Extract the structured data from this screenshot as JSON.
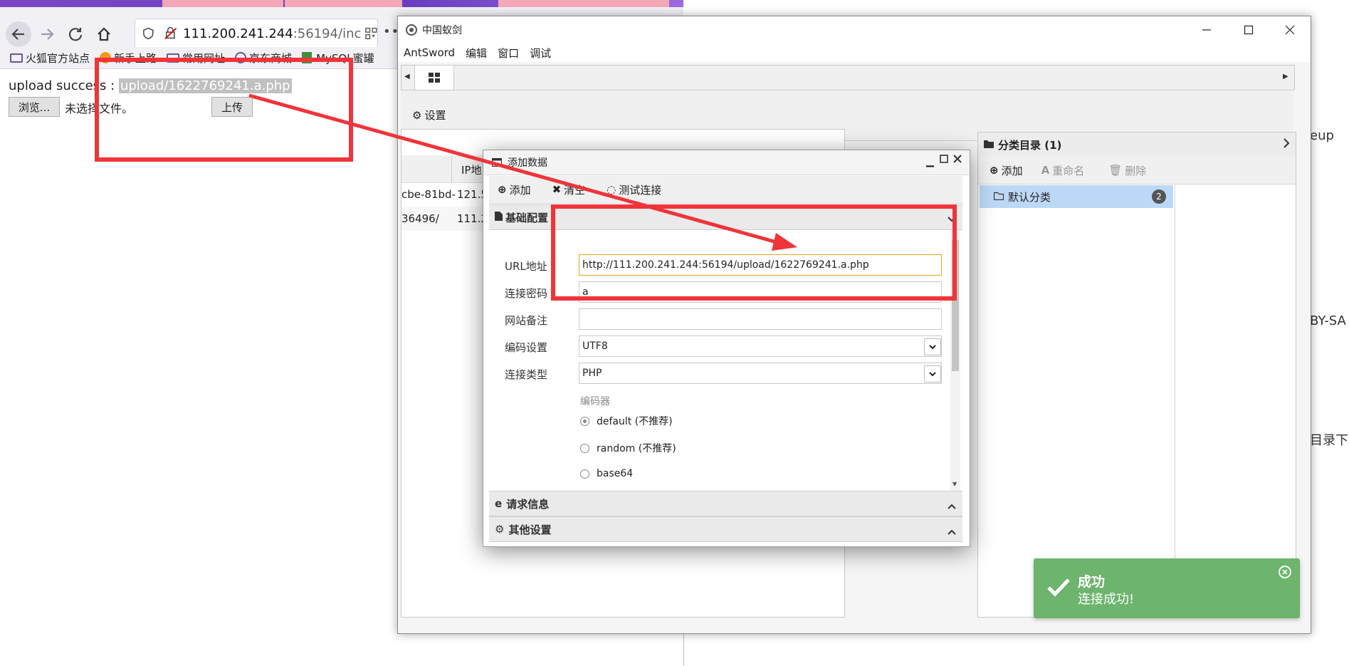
{
  "browser": {
    "url_host": "111.200.241.244",
    "url_rest": ":56194/inc",
    "bookmarks": [
      "火狐官方站点",
      "新手上路",
      "常用网址",
      "京东商城",
      "MySQL蜜罐"
    ],
    "menu_dots": "•••"
  },
  "page": {
    "upload_prefix": "upload success : ",
    "upload_path": "upload/1622769241.a.php",
    "browse_button": "浏览...",
    "no_file_text": "未选择文件。",
    "upload_button": "上传"
  },
  "right_fragments": {
    "frag1": "eup",
    "frag2": "BY-SA",
    "frag3": "目录下"
  },
  "antsword": {
    "window_title": "中国蚁剑",
    "menu": [
      "AntSword",
      "编辑",
      "窗口",
      "调试"
    ],
    "settings_label": "设置",
    "table": {
      "header_ip": "IP地",
      "rows": [
        {
          "url": "cbe-81bd-",
          "ip": "121.5"
        },
        {
          "url": "36496/",
          "ip": "111.2"
        }
      ]
    },
    "category": {
      "title": "分类目录 (1)",
      "add": "添加",
      "rename": "重命名",
      "delete": "删除",
      "default_item": "默认分类",
      "default_count": "2"
    }
  },
  "dialog": {
    "title": "添加数据",
    "toolbar": {
      "add": "添加",
      "clear": "清空",
      "test": "测试连接"
    },
    "section_basic": "基础配置",
    "fields": {
      "url_label": "URL地址",
      "url_value": "http://111.200.241.244:56194/upload/1622769241.a.php",
      "password_label": "连接密码",
      "password_value": "a",
      "note_label": "网站备注",
      "note_value": "",
      "encoding_label": "编码设置",
      "encoding_value": "UTF8",
      "type_label": "连接类型",
      "type_value": "PHP",
      "required_mark": "*"
    },
    "encoder_label": "编码器",
    "encoders": [
      "default (不推荐)",
      "random (不推荐)",
      "base64"
    ],
    "selected_encoder_index": 0,
    "section_request": "请求信息",
    "section_other": "其他设置"
  },
  "toast": {
    "title": "成功",
    "message": "连接成功!"
  },
  "colors": {
    "annotation_red": "#f0343a",
    "toast_green": "#6db46d",
    "selected_item_blue": "#bcd8f7",
    "url_field_border": "#e5a128"
  }
}
